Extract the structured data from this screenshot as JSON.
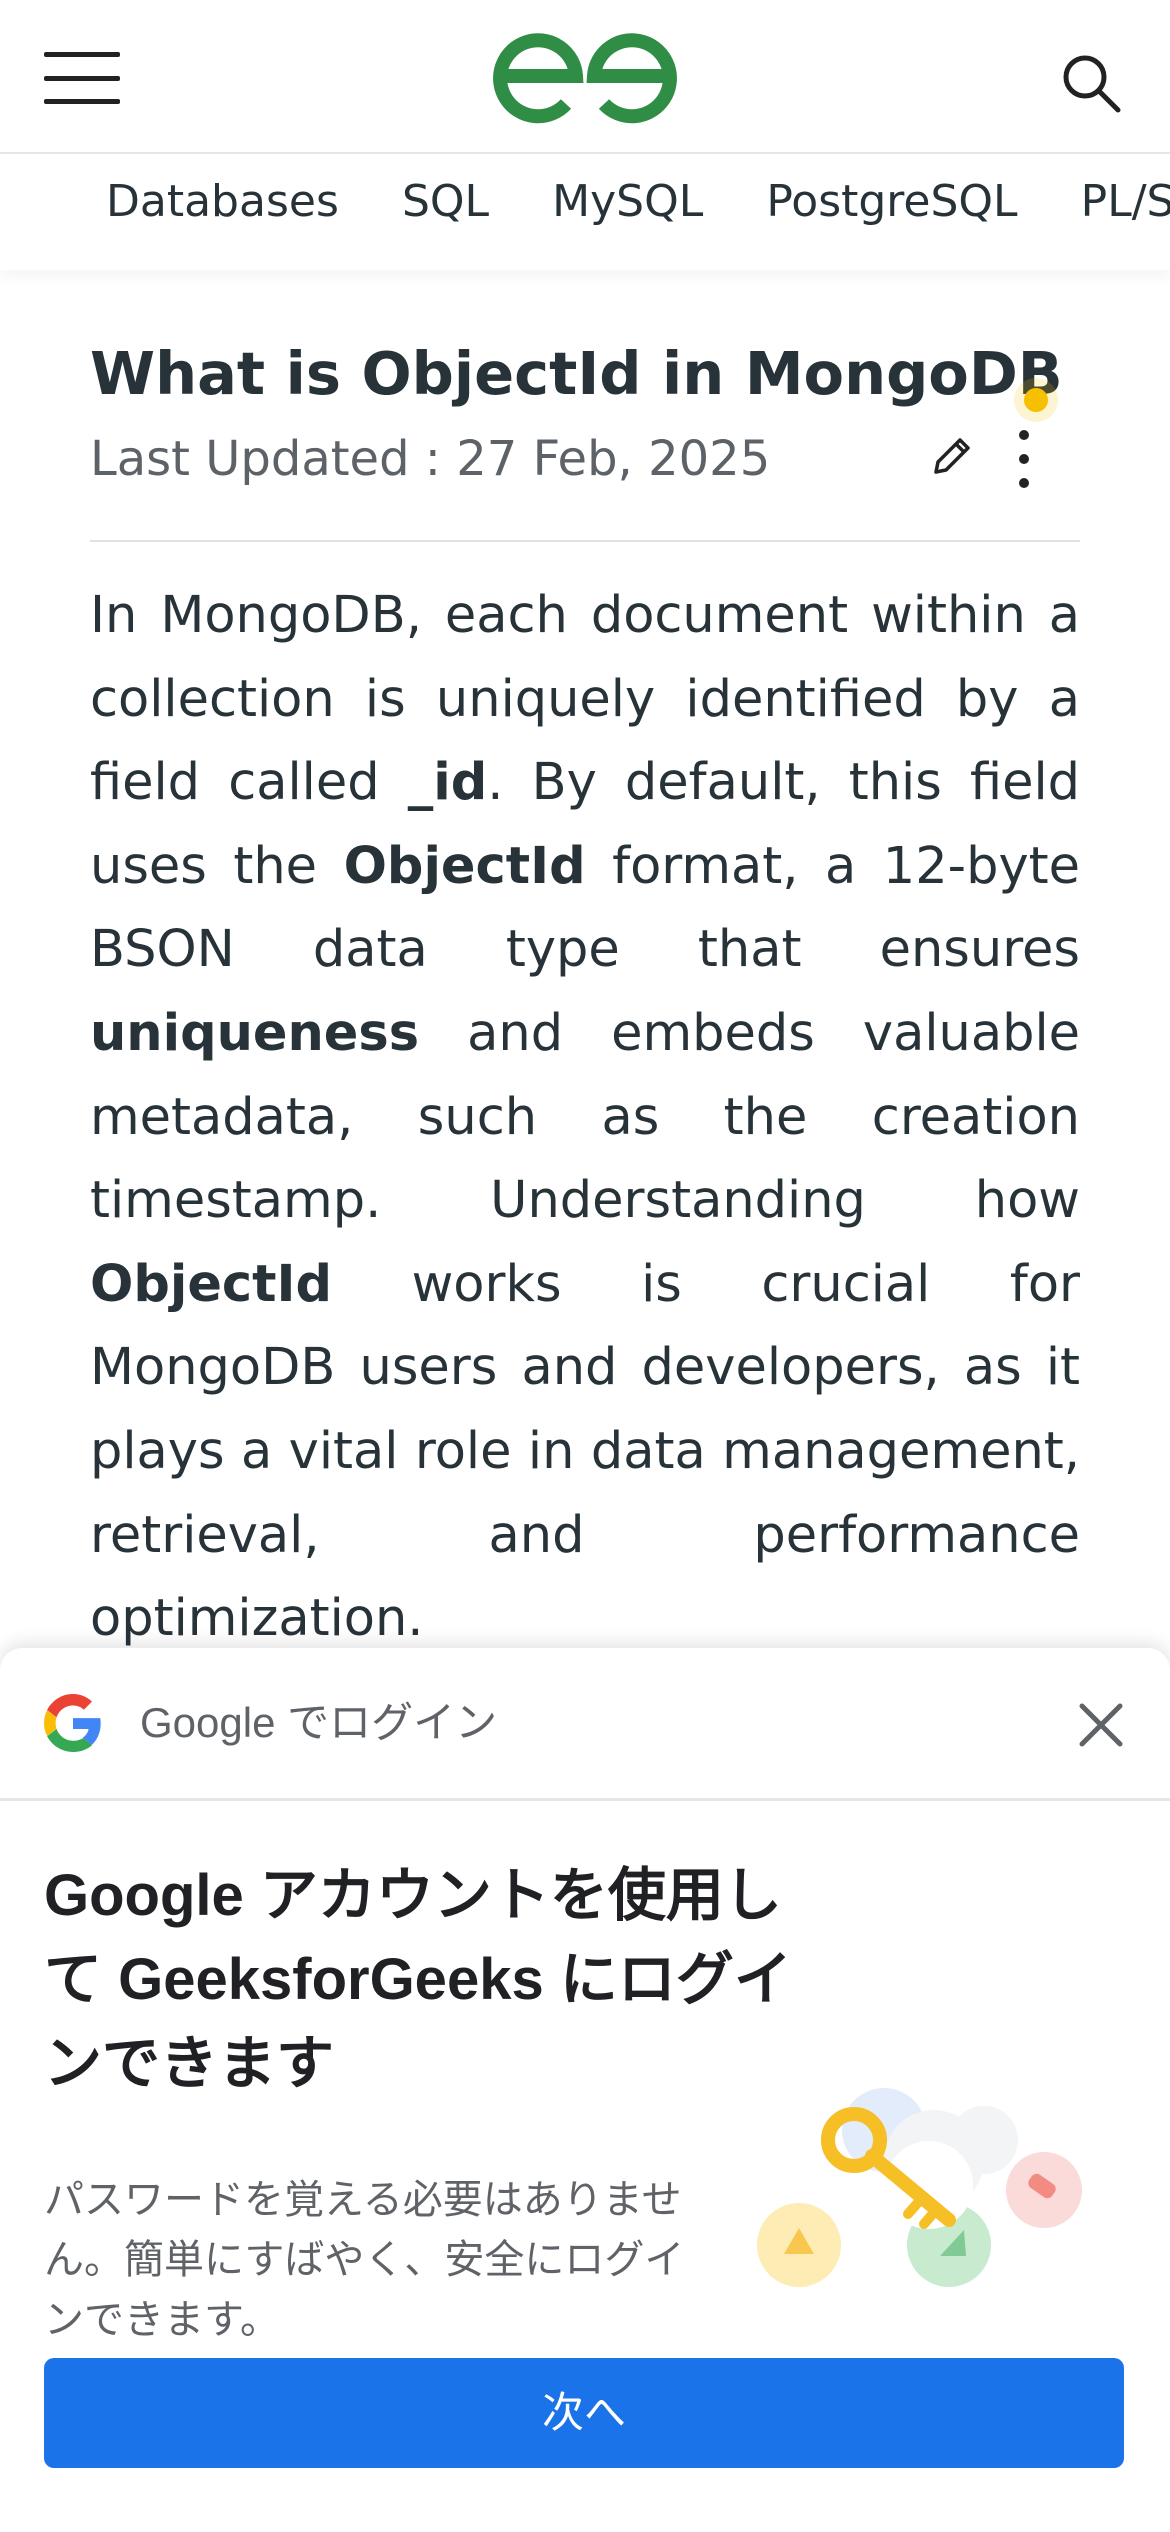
{
  "header": {
    "logo": "geeksforgeeks-logo",
    "menu_icon": "hamburger-menu-icon",
    "search_icon": "search-icon"
  },
  "subnav": {
    "items": [
      {
        "label": "Databases"
      },
      {
        "label": "SQL"
      },
      {
        "label": "MySQL"
      },
      {
        "label": "PostgreSQL"
      },
      {
        "label": "PL/SQL"
      }
    ]
  },
  "article": {
    "title": "What is ObjectId in MongoDB",
    "last_updated": "Last Updated : 27 Feb, 2025",
    "body": {
      "p1": "In MongoDB, each document within a collection is uniquely identified by a field called ",
      "b1": "_id",
      "p2": ". By default, this field uses the ",
      "b2": "ObjectId",
      "p3": " format, a 12-byte BSON data type that ensures ",
      "b3": "uniqueness",
      "p4": " and embeds valuable metadata, such as the creation timestamp. Understanding how ",
      "b4": "ObjectId",
      "p5": " works is crucial for MongoDB users and developers, as it plays a vital role in data management, retrieval, and performance optimization."
    }
  },
  "google_sheet": {
    "title": "Google でログイン",
    "heading": "Google アカウントを使用して GeeksforGeeks にログインできます",
    "description": "パスワードを覚える必要はありません。簡単にすばやく、安全にログインできます。",
    "next_button": "次へ",
    "colors": {
      "button": "#1a73e8"
    }
  },
  "colors": {
    "brand_green": "#2f8d46",
    "notification_dot": "#f6c000"
  }
}
